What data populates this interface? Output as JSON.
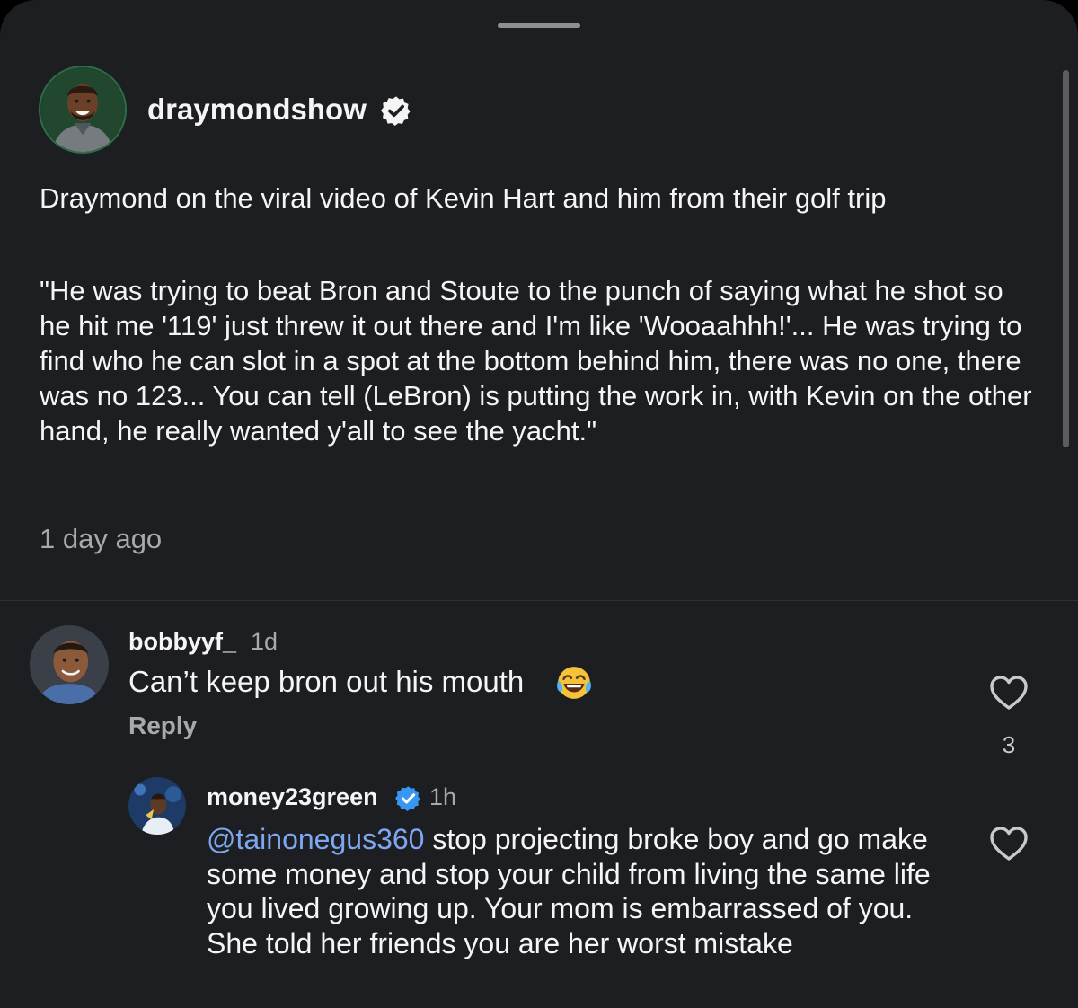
{
  "post": {
    "username": "draymondshow",
    "caption": "Draymond on the viral video of Kevin Hart and him from their golf trip",
    "quote": "\"He was trying to beat Bron and Stoute to the punch of saying what he shot so he hit me '119' just threw it out there and I'm like 'Wooaahhh!'... He was trying to find who he can slot in a spot at the bottom behind him, there was no one, there was no 123... You can tell (LeBron) is putting the work in, with Kevin on the other hand, he really wanted y'all to see the yacht.\"",
    "timestamp": "1 day ago"
  },
  "comments": [
    {
      "username": "bobbyyf_",
      "time": "1d",
      "text": "Can’t keep bron out his mouth",
      "emoji": "face-with-tears-of-joy",
      "reply_label": "Reply",
      "likes": "3"
    },
    {
      "username": "money23green",
      "verified": true,
      "time": "1h",
      "mention": "@tainonegus360",
      "text": " stop projecting broke boy and go make some money and stop your child from living the same life you lived growing up. Your mom is embarrassed of you. She told her friends you are her worst mistake"
    }
  ],
  "colors": {
    "background": "#1c1e21",
    "text": "#f5f5f5",
    "secondary_text": "#a8a9ad",
    "mention": "#7fa6f0",
    "verified_blue": "#3897f0"
  },
  "icons": {
    "verified": "verified-badge-icon",
    "like": "heart-outline-icon"
  }
}
